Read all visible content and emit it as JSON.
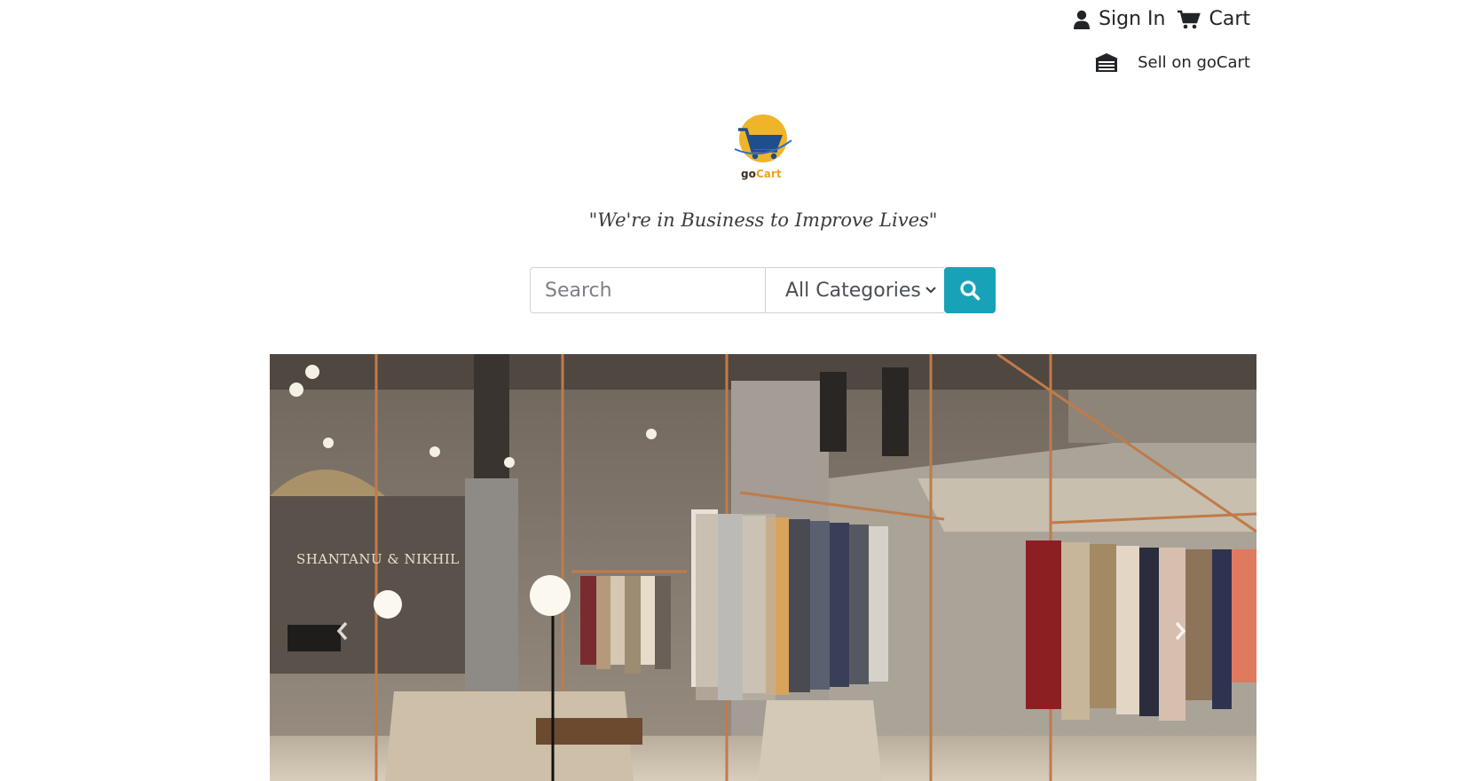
{
  "header": {
    "sign_in_label": "Sign In",
    "cart_label": "Cart",
    "sell_label": "Sell on goCart"
  },
  "brand": {
    "logo_text": "goCart",
    "tagline": "\"We're in Business to Improve Lives\"",
    "colors": {
      "logo_circle": "#f0b429",
      "logo_cart": "#1f4e8c",
      "logo_text_go": "#3d2b1f",
      "logo_text_cart": "#f0a020"
    }
  },
  "search": {
    "placeholder": "Search",
    "category_selected": "All Categories",
    "button_icon": "search-icon",
    "button_color": "#17a2b8"
  },
  "carousel": {
    "slide_alt": "Clothing store interior with suit jackets on racks",
    "store_sign": "SHANTANU & NIKHIL",
    "prev_icon": "chevron-left-icon",
    "next_icon": "chevron-right-icon"
  },
  "icons": {
    "user": "user-icon",
    "cart": "cart-icon",
    "store": "store-icon"
  }
}
